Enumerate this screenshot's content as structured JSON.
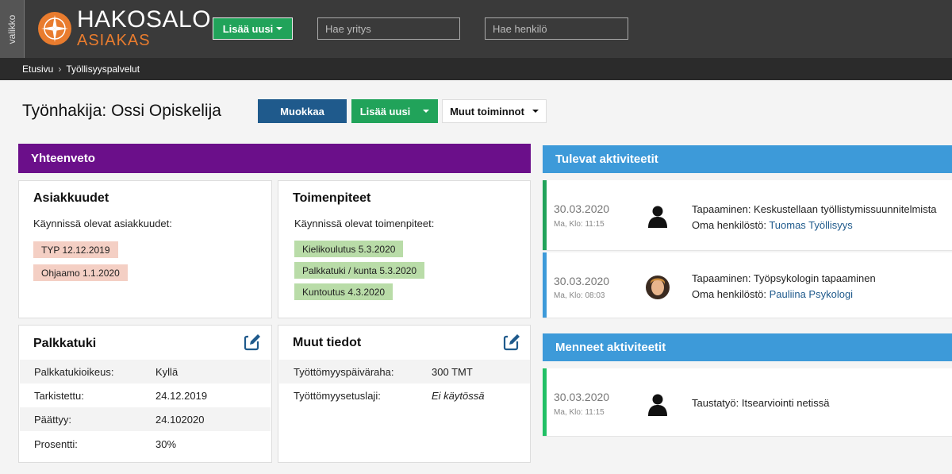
{
  "topbar": {
    "menu_label": "valikko",
    "logo_main": "HAKOSALO",
    "logo_sub": "ASIAKAS",
    "add_new_label": "Lisää uusi",
    "company_search_placeholder": "Hae yritys",
    "person_search_placeholder": "Hae henkilö"
  },
  "breadcrumb": {
    "items": [
      "Etusivu",
      "Työllisyyspalvelut"
    ],
    "separator": "›"
  },
  "page": {
    "title": "Työnhakija: Ossi Opiskelija",
    "edit_label": "Muokkaa",
    "add_new_label": "Lisää uusi",
    "more_actions_label": "Muut toiminnot"
  },
  "summary": {
    "header": "Yhteenveto",
    "clienthood": {
      "title": "Asiakkuudet",
      "lead": "Käynnissä olevat asiakkuudet:",
      "tags": [
        "TYP 12.12.2019",
        "Ohjaamo 1.1.2020"
      ]
    },
    "measures": {
      "title": "Toimenpiteet",
      "lead": "Käynnissä olevat toimenpiteet:",
      "tags": [
        "Kielikoulutus 5.3.2020",
        "Palkkatuki / kunta 5.3.2020",
        "Kuntoutus 4.3.2020"
      ]
    },
    "wage_subsidy": {
      "title": "Palkkatuki",
      "rows": [
        {
          "k": "Palkkatukioikeus:",
          "v": "Kyllä"
        },
        {
          "k": "Tarkistettu:",
          "v": "24.12.2019"
        },
        {
          "k": "Päättyy:",
          "v": "24.102020"
        },
        {
          "k": "Prosentti:",
          "v": "30%"
        }
      ]
    },
    "other_info": {
      "title": "Muut tiedot",
      "rows": [
        {
          "k": "Työttömyyspäiväraha:",
          "v": "300 TMT"
        },
        {
          "k": "Työttömyysetuslaji:",
          "v": "Ei käytössä"
        }
      ]
    }
  },
  "upcoming": {
    "header": "Tulevat aktiviteetit",
    "items": [
      {
        "date": "30.03.2020",
        "time": "Ma, Klo: 11:15",
        "title": "Tapaaminen: Keskustellaan työllistymissuunnitelmista",
        "staff_prefix": "Oma henkilöstö:",
        "staff_name": "Tuomas Työllisyys"
      },
      {
        "date": "30.03.2020",
        "time": "Ma, Klo: 08:03",
        "title": "Tapaaminen: Työpsykologin tapaaminen",
        "staff_prefix": "Oma henkilöstö:",
        "staff_name": "Pauliina Psykologi"
      }
    ]
  },
  "past": {
    "header": "Menneet aktiviteetit",
    "items": [
      {
        "date": "30.03.2020",
        "time": "Ma, Klo: 11:15",
        "title": "Taustatyö: Itsearviointi netissä"
      }
    ]
  },
  "colors": {
    "summary_header": "#6b0f8a",
    "panel_header": "#3d9ad9",
    "upcoming_bar": "#21a35a",
    "past_bar": "#21c065",
    "primary_button": "#1f5a8c",
    "add_button": "#21a35a",
    "logo_accent": "#e97c2e"
  }
}
